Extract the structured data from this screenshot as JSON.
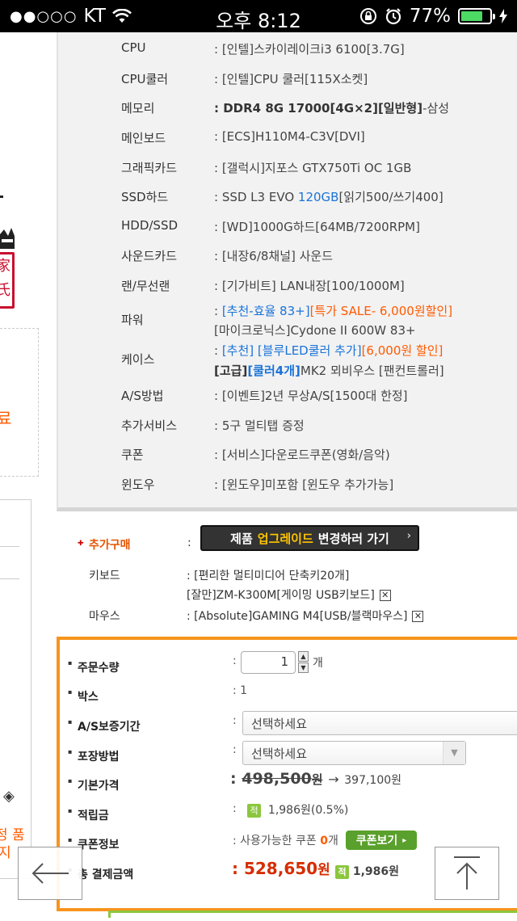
{
  "statusbar": {
    "signal": "●●○○○",
    "carrier": "KT",
    "time": "오후 8:12",
    "battery": "77%"
  },
  "left_fragments": {
    "orange_char": "료",
    "bottom_text_1": "정 품",
    "bottom_text_2": "지",
    "diamond": "◈"
  },
  "specs": [
    {
      "label": "CPU",
      "value": ": [인텔]스카이레이크i3 6100[3.7G]"
    },
    {
      "label": "CPU쿨러",
      "value": ": [인텔]CPU 쿨러[115X소켓]"
    },
    {
      "label": "메모리",
      "value_bold": ": DDR4 8G 17000[4G×2][일반형]",
      "value_rest": "-삼성"
    },
    {
      "label": "메인보드",
      "value": ": [ECS]H110M4-C3V[DVI]"
    },
    {
      "label": "그래픽카드",
      "value": ": [갤럭시]지포스 GTX750Ti OC 1GB"
    },
    {
      "label": "SSD하드",
      "value_pre": ": SSD L3 EVO ",
      "value_blue": "120GB",
      "value_post": "[읽기500/쓰기400]"
    },
    {
      "label": "HDD/SSD",
      "value": ": [WD]1000G하드[64MB/7200RPM]"
    },
    {
      "label": "사운드카드",
      "value": ": [내장6/8채널] 사운드"
    },
    {
      "label": "랜/무선랜",
      "value": ": [기가비트] LAN내장[100/1000M]"
    },
    {
      "label": "파워",
      "line1_colon": ": ",
      "line1_blue": "[추천-효율 83+]",
      "line1_orange": "[특가 SALE- 6,000원할인]",
      "line2": "[마이크로닉스]Cydone II 600W 83+"
    },
    {
      "label": "케이스",
      "line1_colon": ": ",
      "line1_blue": "[추천] [블루LED쿨러 추가]",
      "line1_orange": "[6,000원 할인]",
      "line2_bold": "[고급]",
      "line2_blue": "[쿨러4개]",
      "line2_rest": "MK2 뫼비우스 [팬컨트롤러]"
    },
    {
      "label": "A/S방법",
      "value": ": [이벤트]2년 무상A/S[1500대 한정]"
    },
    {
      "label": "추가서비스",
      "value": ": 5구 멀티탭 증정"
    },
    {
      "label": "쿠폰",
      "value": ": [서비스]다운로드쿠폰(영화/음악)"
    },
    {
      "label": "윈도우",
      "value": ": [윈도우]미포함 [윈도우 추가가능]"
    }
  ],
  "extra": {
    "title": "추가구매",
    "colon": ":",
    "upgrade_btn_pre": "제품",
    "upgrade_btn_hl": "업그레이드",
    "upgrade_btn_post": "변경하러 가기",
    "keyboard_label": "키보드",
    "keyboard_line1": ": [편리한 멀티미디어 단축키20개]",
    "keyboard_line2": "[잘만]ZM-K300M[게이밍 USB키보드]",
    "mouse_label": "마우스",
    "mouse_value": ": [Absolute]GAMING M4[USB/블랙마우스]"
  },
  "order": {
    "qty_label": "주문수량",
    "qty_value": "1",
    "qty_unit": "개",
    "box_label": "박스",
    "box_value": ": 1",
    "as_label": "A/S보증기간",
    "as_select": "선택하세요",
    "pack_label": "포장방법",
    "pack_select": "선택하세요",
    "base_label": "기본가격",
    "base_old": "498,500",
    "won": "원",
    "arrow": "→",
    "base_new": "397,100원",
    "points_label": "적립금",
    "points_badge": "적",
    "points_value": "1,986원(0.5%)",
    "coupon_label": "쿠폰정보",
    "coupon_text_pre": ": 사용가능한 쿠폰",
    "coupon_count": "0",
    "coupon_unit": "개",
    "coupon_btn": "쿠폰보기",
    "total_label": "총 결제금액",
    "total_value": "528,650",
    "total_won": "원",
    "total_points": "1,986원"
  }
}
